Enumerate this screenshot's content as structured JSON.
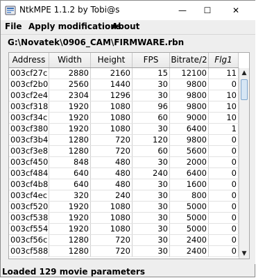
{
  "window": {
    "title": "NtkMPE 1.1.2 by Tobi@s",
    "minimize_glyph": "—",
    "maximize_glyph": "☐",
    "close_glyph": "✕",
    "icon": "app-icon"
  },
  "menu": {
    "items": [
      {
        "label": "File"
      },
      {
        "label": "Apply modifications"
      },
      {
        "label": "About"
      }
    ]
  },
  "file_path": "G:\\Novatek\\0906_CAM\\FIRMWARE.rbn",
  "table": {
    "columns": [
      "Address",
      "Width",
      "Height",
      "FPS",
      "Bitrate/2",
      "Flg1"
    ],
    "rows": [
      [
        "003cf27c",
        "2880",
        "2160",
        "15",
        "12100",
        "11"
      ],
      [
        "003cf2b0",
        "2560",
        "1440",
        "30",
        "9800",
        "0"
      ],
      [
        "003cf2e4",
        "2304",
        "1296",
        "30",
        "9800",
        "10"
      ],
      [
        "003cf318",
        "1920",
        "1080",
        "96",
        "9800",
        "10"
      ],
      [
        "003cf34c",
        "1920",
        "1080",
        "60",
        "9000",
        "10"
      ],
      [
        "003cf380",
        "1920",
        "1080",
        "30",
        "6400",
        "1"
      ],
      [
        "003cf3b4",
        "1280",
        "720",
        "120",
        "9800",
        "0"
      ],
      [
        "003cf3e8",
        "1280",
        "720",
        "60",
        "5600",
        "0"
      ],
      [
        "003cf450",
        "848",
        "480",
        "30",
        "2000",
        "0"
      ],
      [
        "003cf484",
        "640",
        "480",
        "240",
        "6400",
        "0"
      ],
      [
        "003cf4b8",
        "640",
        "480",
        "30",
        "1600",
        "0"
      ],
      [
        "003cf4ec",
        "320",
        "240",
        "30",
        "800",
        "0"
      ],
      [
        "003cf520",
        "1920",
        "1080",
        "30",
        "5000",
        "0"
      ],
      [
        "003cf538",
        "1920",
        "1080",
        "30",
        "5000",
        "0"
      ],
      [
        "003cf554",
        "1920",
        "1080",
        "30",
        "5000",
        "0"
      ],
      [
        "003cf56c",
        "1280",
        "720",
        "30",
        "2400",
        "0"
      ],
      [
        "003cf588",
        "1280",
        "720",
        "30",
        "2400",
        "0"
      ]
    ]
  },
  "scrollbar": {
    "up_glyph": "▲",
    "down_glyph": "▼"
  },
  "status": "Loaded 129 movie parameters"
}
